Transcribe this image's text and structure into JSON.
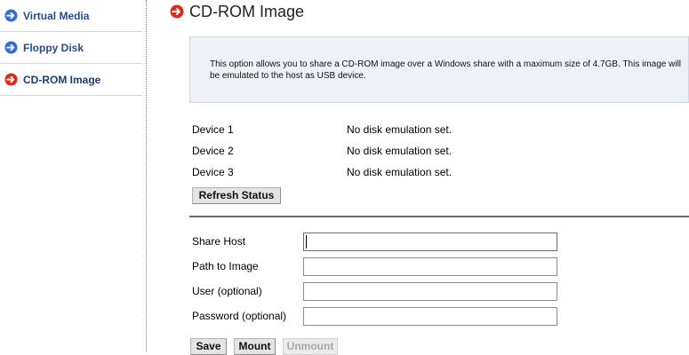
{
  "sidebar": {
    "items": [
      {
        "label": "Virtual Media",
        "icon": "arrow-right-circle-icon",
        "color": "#2f6fd6"
      },
      {
        "label": "Floppy Disk",
        "icon": "arrow-right-circle-icon",
        "color": "#2f6fd6"
      },
      {
        "label": "CD-ROM Image",
        "icon": "arrow-right-circle-icon",
        "color": "#e0281e",
        "active": true
      }
    ]
  },
  "page": {
    "title": "CD-ROM Image",
    "title_icon": "arrow-right-circle-icon",
    "title_icon_color": "#e0281e"
  },
  "info": {
    "text": "This option allows you to share a CD-ROM image over a Windows share with a maximum size of 4.7GB. This image will be emulated to the host as USB device."
  },
  "devices": [
    {
      "label": "Device 1",
      "status": "No disk emulation set."
    },
    {
      "label": "Device 2",
      "status": "No disk emulation set."
    },
    {
      "label": "Device 3",
      "status": "No disk emulation set."
    }
  ],
  "buttons": {
    "refresh": "Refresh Status",
    "save": "Save",
    "mount": "Mount",
    "unmount": "Unmount"
  },
  "form": {
    "share_host": {
      "label": "Share Host",
      "value": ""
    },
    "path": {
      "label": "Path to Image",
      "value": ""
    },
    "user": {
      "label": "User (optional)",
      "value": ""
    },
    "password": {
      "label": "Password (optional)",
      "value": ""
    }
  }
}
